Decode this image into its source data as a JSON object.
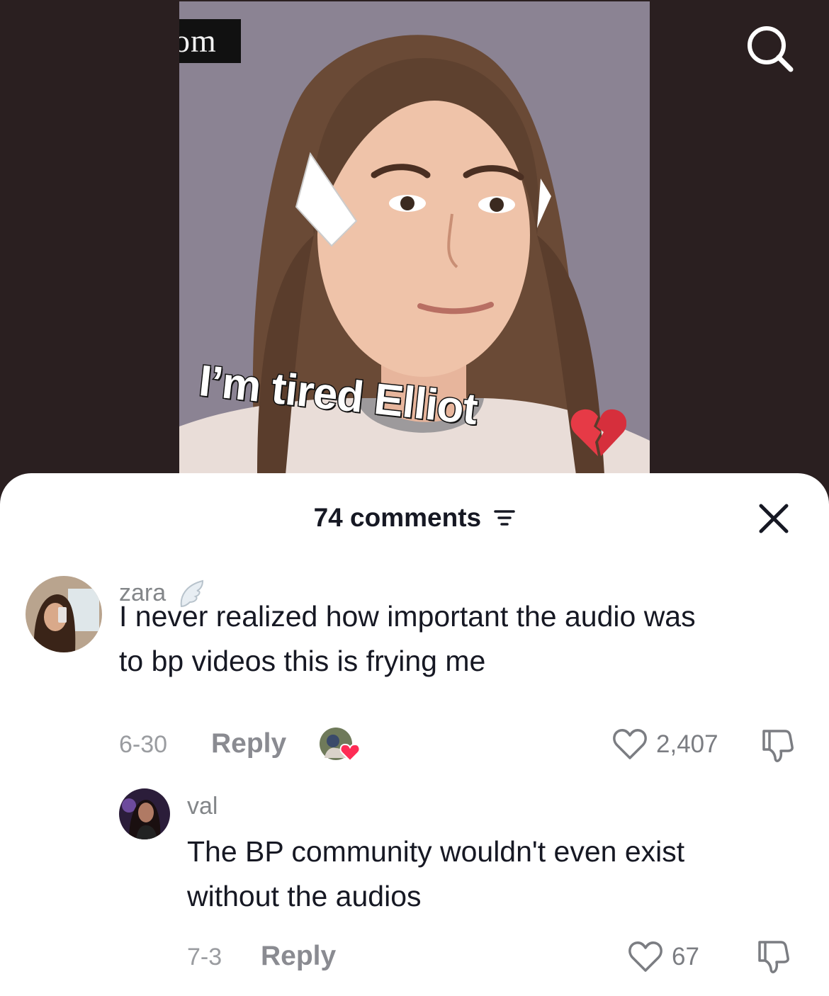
{
  "video": {
    "watermark_text": "om",
    "caption": "I’m tired Elliot",
    "caption_emoji": "broken-heart-icon"
  },
  "comments_sheet": {
    "count_label": "74 comments",
    "comments": [
      {
        "username": "zara",
        "username_badge": "angel-wing-icon",
        "text_line1": "I never realized how important the audio was",
        "text_line2": "to bp videos this is frying me",
        "date": "6-30",
        "reply_label": "Reply",
        "likes": "2,407",
        "creator_liked": true
      },
      {
        "username": "val",
        "text_line1": "The BP community wouldn't even exist",
        "text_line2": "without the audios",
        "date": "7-3",
        "reply_label": "Reply",
        "likes": "67"
      }
    ]
  },
  "colors": {
    "background_dark": "#2a1f20",
    "sheet_bg": "#ffffff",
    "text_primary": "#161823",
    "text_secondary": "#838689",
    "like_heart_badge": "#fe2c55"
  }
}
